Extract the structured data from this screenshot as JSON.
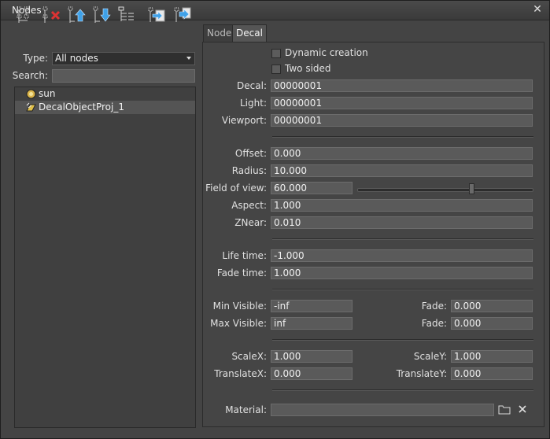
{
  "window": {
    "title": "Nodes"
  },
  "toolbar": {
    "icons": [
      "node-tree-icon",
      "delete-node-icon",
      "move-up-icon",
      "move-down-icon",
      "list-icon",
      "import-icon",
      "export-icon"
    ]
  },
  "filter": {
    "type_label": "Type:",
    "type_value": "All nodes",
    "search_label": "Search:",
    "search_value": ""
  },
  "tree": {
    "items": [
      {
        "label": "sun",
        "icon": "world-light-icon",
        "selected": false
      },
      {
        "label": "DecalObjectProj_1",
        "icon": "decal-icon",
        "selected": true
      }
    ]
  },
  "tabs": [
    {
      "label": "Node",
      "active": false
    },
    {
      "label": "Decal",
      "active": true
    }
  ],
  "decal": {
    "dynamic_creation_label": "Dynamic creation",
    "dynamic_creation_checked": false,
    "two_sided_label": "Two sided",
    "two_sided_checked": false,
    "decal_label": "Decal:",
    "decal_value": "00000001",
    "light_label": "Light:",
    "light_value": "00000001",
    "viewport_label": "Viewport:",
    "viewport_value": "00000001",
    "offset_label": "Offset:",
    "offset_value": "0.000",
    "radius_label": "Radius:",
    "radius_value": "10.000",
    "fov_label": "Field of view:",
    "fov_value": "60.000",
    "fov_slider_fraction": 0.65,
    "aspect_label": "Aspect:",
    "aspect_value": "1.000",
    "znear_label": "ZNear:",
    "znear_value": "0.010",
    "life_time_label": "Life time:",
    "life_time_value": "-1.000",
    "fade_time_label": "Fade time:",
    "fade_time_value": "1.000",
    "min_visible_label": "Min Visible:",
    "min_visible_value": "-inf",
    "min_fade_label": "Fade:",
    "min_fade_value": "0.000",
    "max_visible_label": "Max Visible:",
    "max_visible_value": "inf",
    "max_fade_label": "Fade:",
    "max_fade_value": "0.000",
    "scale_x_label": "ScaleX:",
    "scale_x_value": "1.000",
    "scale_y_label": "ScaleY:",
    "scale_y_value": "1.000",
    "translate_x_label": "TranslateX:",
    "translate_x_value": "0.000",
    "translate_y_label": "TranslateY:",
    "translate_y_value": "0.000",
    "material_label": "Material:",
    "material_value": ""
  }
}
